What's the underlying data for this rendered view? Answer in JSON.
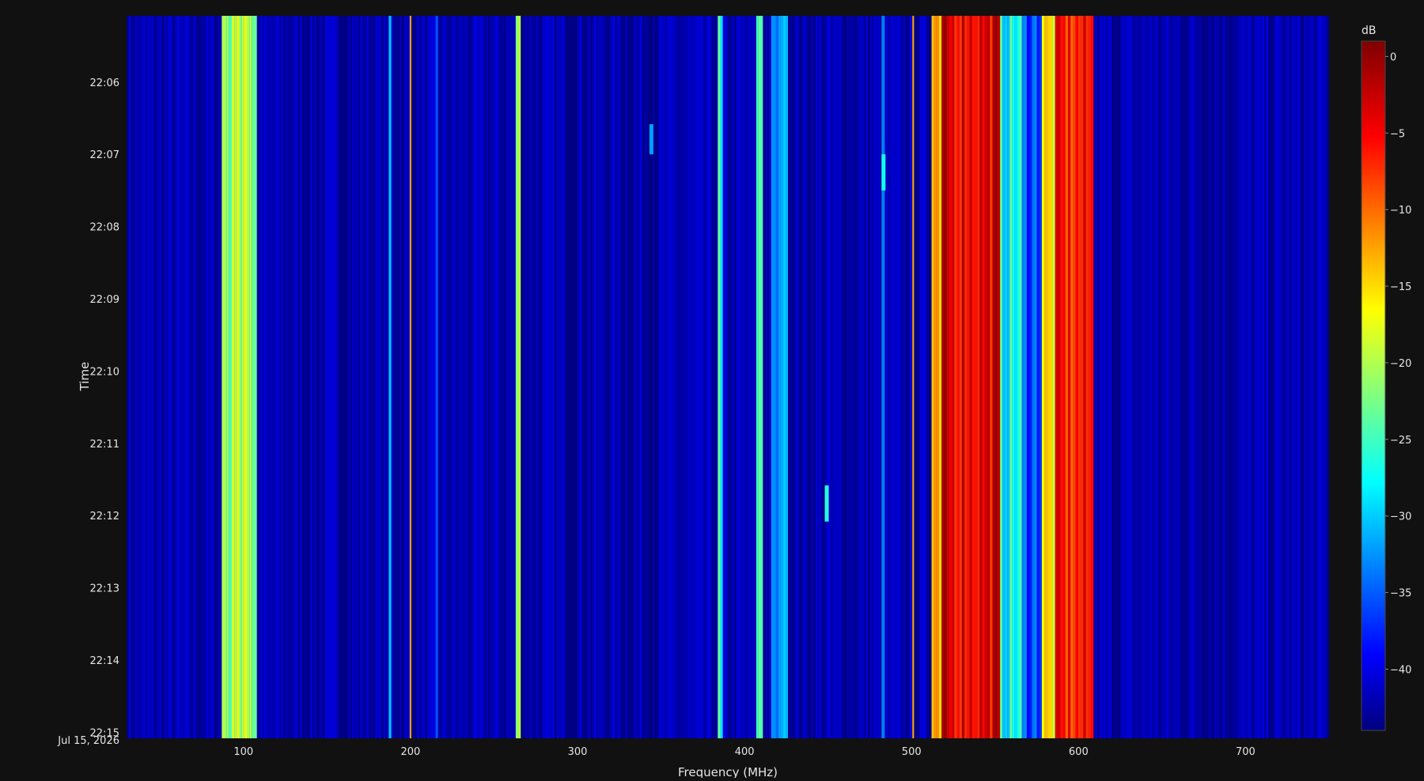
{
  "chart_data": {
    "type": "heatmap",
    "title": "",
    "xlabel": "Frequency (MHz)",
    "ylabel": "Time",
    "xlim": [
      30,
      750
    ],
    "x_ticks": [
      "100",
      "200",
      "300",
      "400",
      "500",
      "600",
      "700"
    ],
    "y_ticks": [
      "22:06",
      "22:07",
      "22:08",
      "22:09",
      "22:10",
      "22:11",
      "22:12",
      "22:13",
      "22:14",
      "22:15"
    ],
    "y_date_label": "Jul 15, 2026",
    "time_range": [
      "2026-07-15 22:05:05",
      "2026-07-15 22:15:05"
    ],
    "colorbar": {
      "title": "dB",
      "range": [
        -44,
        1
      ],
      "ticks": [
        "0",
        "−5",
        "−10",
        "−15",
        "−20",
        "−25",
        "−30",
        "−35",
        "−40"
      ],
      "colorscale": "jet"
    },
    "background_level_db": -43,
    "signal_bands": [
      {
        "start": 87,
        "end": 108,
        "level_db": -21
      },
      {
        "start": 187,
        "end": 188.5,
        "level_db": -30
      },
      {
        "start": 199.5,
        "end": 200.5,
        "level_db": -12
      },
      {
        "start": 215,
        "end": 216.5,
        "level_db": -32
      },
      {
        "start": 263,
        "end": 266,
        "level_db": -22
      },
      {
        "start": 384,
        "end": 387,
        "level_db": -26
      },
      {
        "start": 407,
        "end": 411,
        "level_db": -24
      },
      {
        "start": 416,
        "end": 426,
        "level_db": -31
      },
      {
        "start": 482,
        "end": 484,
        "level_db": -34
      },
      {
        "start": 500.5,
        "end": 501.5,
        "level_db": -12
      },
      {
        "start": 512,
        "end": 518,
        "level_db": -15
      },
      {
        "start": 518,
        "end": 553,
        "level_db": -4
      },
      {
        "start": 553,
        "end": 566,
        "level_db": -27
      },
      {
        "start": 566,
        "end": 578,
        "level_db": -35
      },
      {
        "start": 578,
        "end": 586,
        "level_db": -16
      },
      {
        "start": 586,
        "end": 609,
        "level_db": -7
      },
      {
        "start": 642,
        "end": 644,
        "level_db": -38
      }
    ],
    "bursts": [
      {
        "freq": 344,
        "time_start": "22:06:35",
        "time_end": "22:07:00",
        "level_db": -32
      },
      {
        "freq": 483,
        "time_start": "22:07:00",
        "time_end": "22:07:30",
        "level_db": -27
      },
      {
        "freq": 449,
        "time_start": "22:11:35",
        "time_end": "22:12:05",
        "level_db": -26
      }
    ]
  }
}
